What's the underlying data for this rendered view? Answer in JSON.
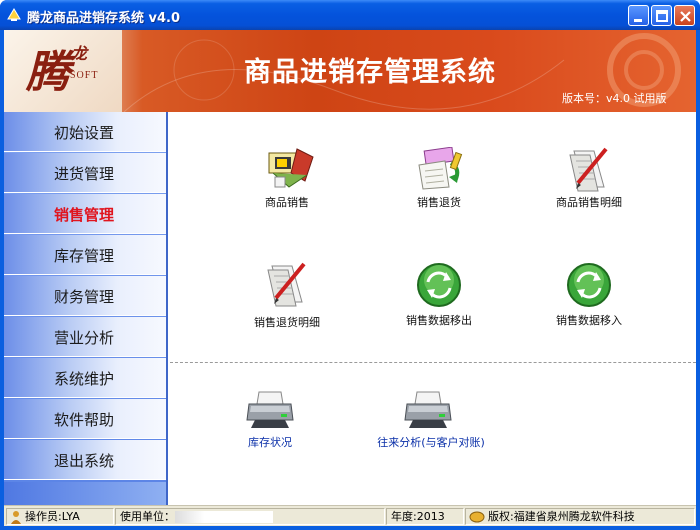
{
  "window": {
    "title": "腾龙商品进销存系统 v4.0"
  },
  "banner": {
    "logo_main": "腾",
    "logo_sub": "龙",
    "logo_soft": "SOFT",
    "title": "商品进销存管理系统",
    "version": "版本号：v4.0 试用版"
  },
  "sidebar": {
    "items": [
      {
        "label": "初始设置",
        "active": false
      },
      {
        "label": "进货管理",
        "active": false
      },
      {
        "label": "销售管理",
        "active": true
      },
      {
        "label": "库存管理",
        "active": false
      },
      {
        "label": "财务管理",
        "active": false
      },
      {
        "label": "营业分析",
        "active": false
      },
      {
        "label": "系统维护",
        "active": false
      },
      {
        "label": "软件帮助",
        "active": false
      },
      {
        "label": "退出系统",
        "active": false
      }
    ]
  },
  "main": {
    "tools": [
      {
        "label": "商品销售",
        "icon": "sales-icon"
      },
      {
        "label": "销售退货",
        "icon": "sales-return-icon"
      },
      {
        "label": "商品销售明细",
        "icon": "sales-detail-icon"
      },
      {
        "label": "销售退货明细",
        "icon": "return-detail-icon"
      },
      {
        "label": "销售数据移出",
        "icon": "data-export-icon"
      },
      {
        "label": "销售数据移入",
        "icon": "data-import-icon"
      }
    ],
    "reports": [
      {
        "label": "库存状况",
        "icon": "printer-icon"
      },
      {
        "label": "往来分析(与客户对账)",
        "icon": "printer-icon"
      }
    ]
  },
  "statusbar": {
    "operator": "操作员:LYA",
    "company_label": "使用单位：",
    "year": "年度:2013",
    "copyright": "版权:福建省泉州腾龙软件科技"
  },
  "colors": {
    "title_bar": "#0453dc",
    "banner": "#ce4414",
    "active_nav": "#e0141e",
    "report_label": "#0a2fa8"
  }
}
